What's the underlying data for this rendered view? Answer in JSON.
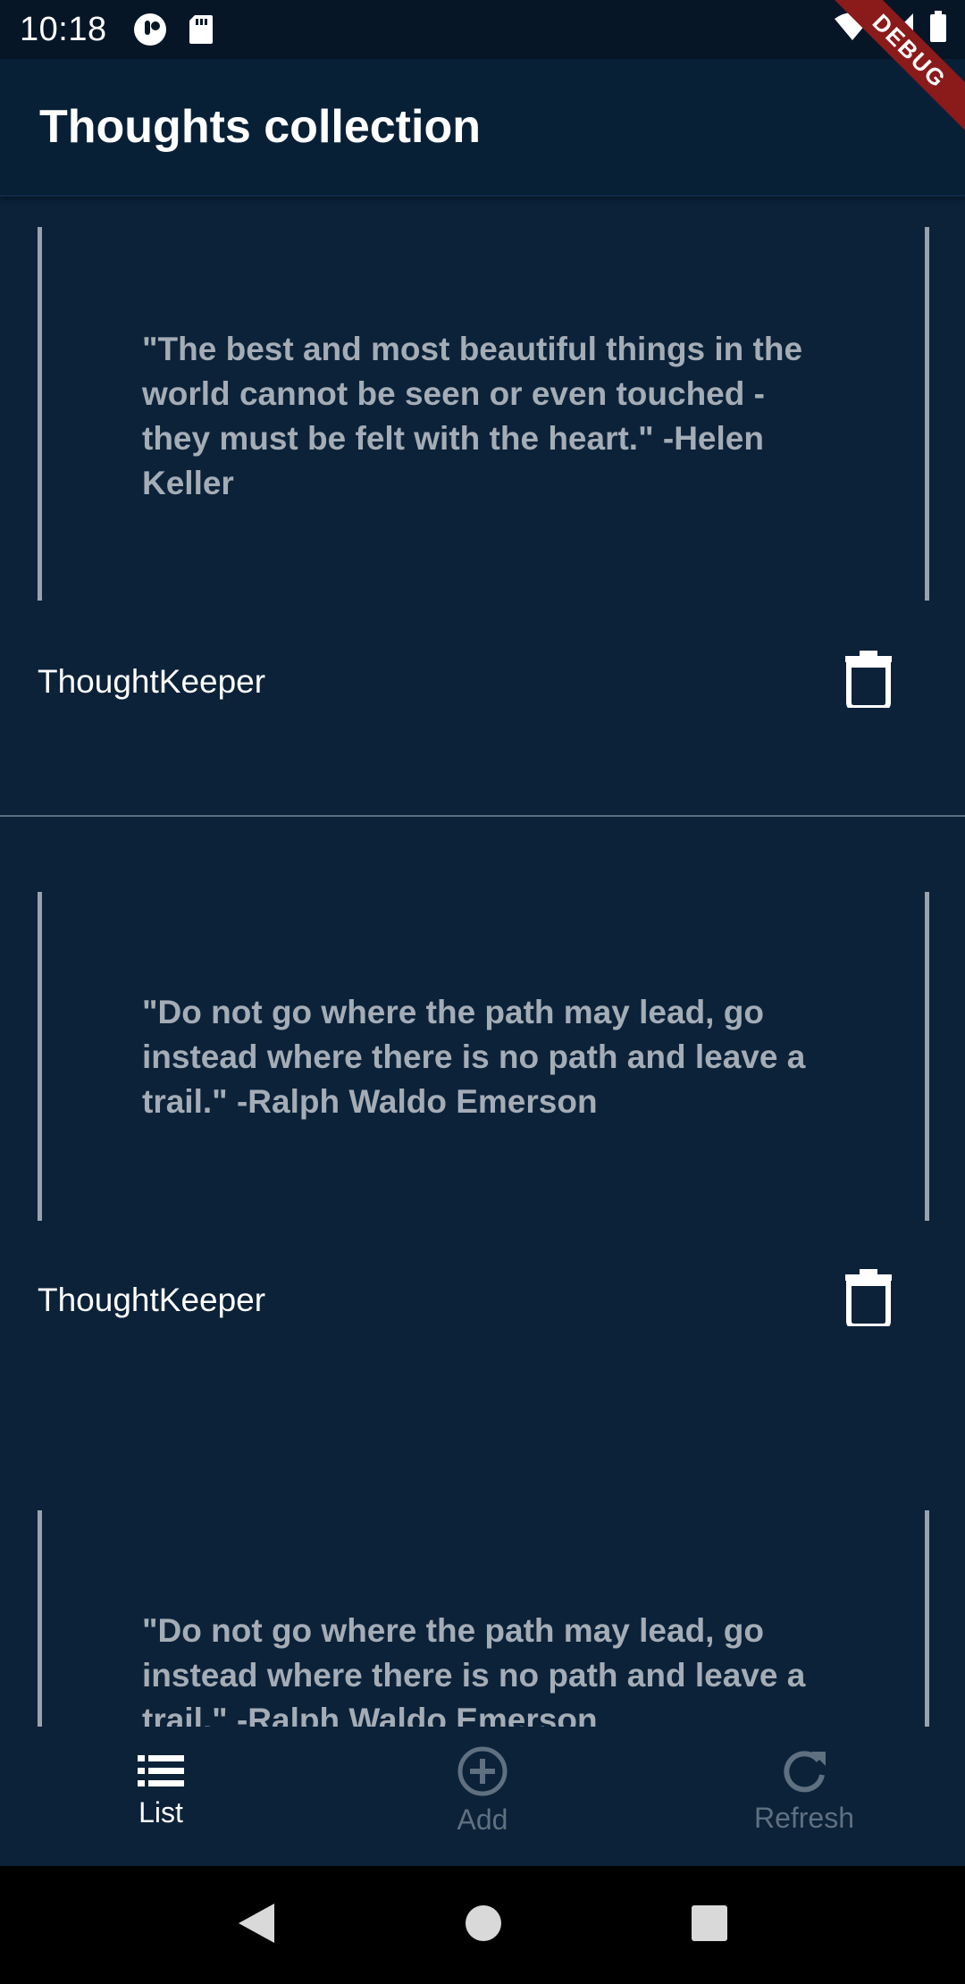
{
  "status_bar": {
    "time": "10:18"
  },
  "debug_banner": "DEBUG",
  "app_bar": {
    "title": "Thoughts collection"
  },
  "thoughts": [
    {
      "quote": "\"The best and most beautiful things in the world cannot be seen or even touched - they must be felt with the heart.\" -Helen Keller",
      "author": "ThoughtKeeper"
    },
    {
      "quote": "\"Do not go where the path may lead, go instead where there is no path and leave a trail.\" -Ralph Waldo Emerson",
      "author": "ThoughtKeeper"
    },
    {
      "quote": "\"Do not go where the path may lead, go instead where there is no path and leave a trail.\" -Ralph Waldo Emerson",
      "author": ""
    }
  ],
  "bottom_nav": {
    "items": [
      {
        "label": "List",
        "icon": "list-icon",
        "active": true
      },
      {
        "label": "Add",
        "icon": "add-circle-icon",
        "active": false
      },
      {
        "label": "Refresh",
        "icon": "refresh-icon",
        "active": false
      }
    ]
  },
  "colors": {
    "background": "#0b2239",
    "app_bar": "#082036",
    "quote_text": "#a4acb5",
    "inactive_nav": "#5f7080",
    "debug_ribbon": "#8b1a1a"
  }
}
